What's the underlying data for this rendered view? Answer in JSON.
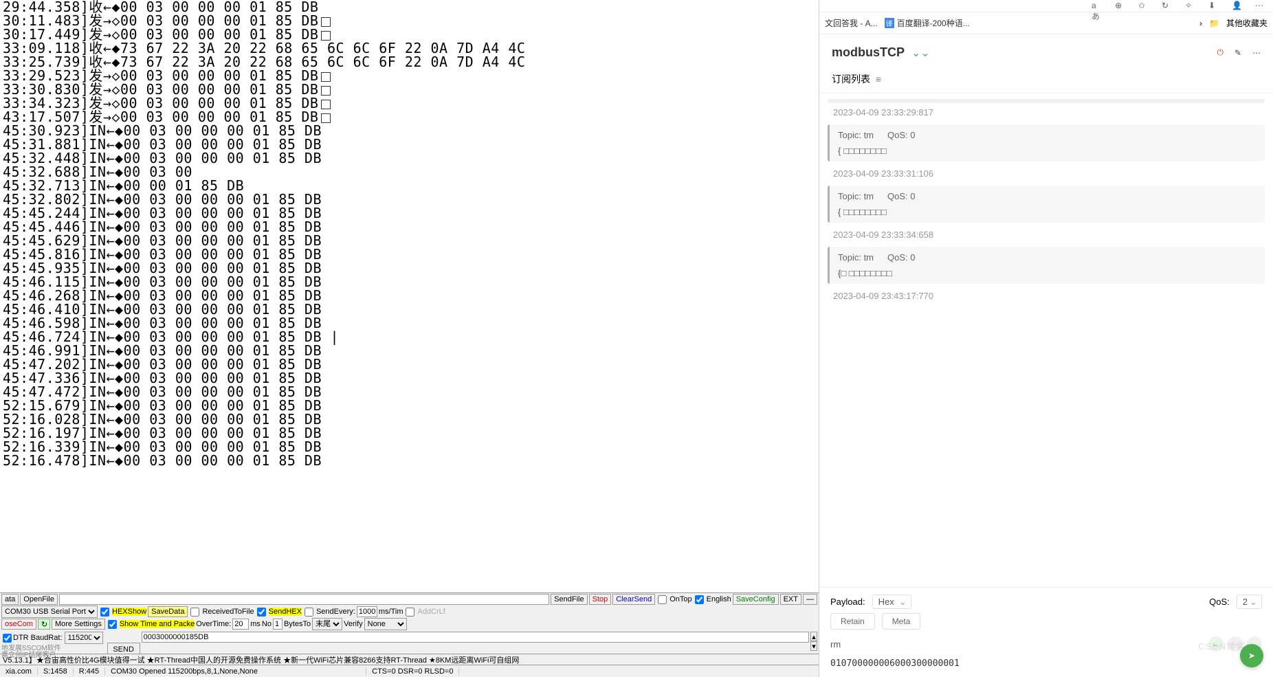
{
  "log": [
    {
      "t": "29:44.358",
      "d": "收←◆",
      "hex": "00 03 00 00 00 01 85 DB",
      "sq": false
    },
    {
      "t": "30:11.483",
      "d": "发→◇",
      "hex": "00 03 00 00 00 01 85 DB",
      "sq": true
    },
    {
      "t": "30:17.449",
      "d": "发→◇",
      "hex": "00 03 00 00 00 01 85 DB",
      "sq": true
    },
    {
      "t": "33:09.118",
      "d": "收←◆",
      "hex": "73 67 22 3A 20 22 68 65 6C 6C 6F 22 0A 7D A4 4C",
      "sq": false
    },
    {
      "t": "33:25.739",
      "d": "收←◆",
      "hex": "73 67 22 3A 20 22 68 65 6C 6C 6F 22 0A 7D A4 4C",
      "sq": false
    },
    {
      "t": "33:29.523",
      "d": "发→◇",
      "hex": "00 03 00 00 00 01 85 DB",
      "sq": true
    },
    {
      "t": "33:30.830",
      "d": "发→◇",
      "hex": "00 03 00 00 00 01 85 DB",
      "sq": true
    },
    {
      "t": "33:34.323",
      "d": "发→◇",
      "hex": "00 03 00 00 00 01 85 DB",
      "sq": true
    },
    {
      "t": "43:17.507",
      "d": "发→◇",
      "hex": "00 03 00 00 00 01 85 DB",
      "sq": true
    },
    {
      "t": "45:30.923",
      "d": "IN←◆",
      "hex": "00 03 00 00 00 01 85 DB",
      "sq": false
    },
    {
      "t": "45:31.881",
      "d": "IN←◆",
      "hex": "00 03 00 00 00 01 85 DB",
      "sq": false
    },
    {
      "t": "45:32.448",
      "d": "IN←◆",
      "hex": "00 03 00 00 00 01 85 DB",
      "sq": false
    },
    {
      "t": "45:32.688",
      "d": "IN←◆",
      "hex": "00 03 00",
      "sq": false
    },
    {
      "t": "45:32.713",
      "d": "IN←◆",
      "hex": "00 00 01 85 DB",
      "sq": false
    },
    {
      "t": "45:32.802",
      "d": "IN←◆",
      "hex": "00 03 00 00 00 01 85 DB",
      "sq": false
    },
    {
      "t": "45:45.244",
      "d": "IN←◆",
      "hex": "00 03 00 00 00 01 85 DB",
      "sq": false
    },
    {
      "t": "45:45.446",
      "d": "IN←◆",
      "hex": "00 03 00 00 00 01 85 DB",
      "sq": false
    },
    {
      "t": "45:45.629",
      "d": "IN←◆",
      "hex": "00 03 00 00 00 01 85 DB",
      "sq": false
    },
    {
      "t": "45:45.816",
      "d": "IN←◆",
      "hex": "00 03 00 00 00 01 85 DB",
      "sq": false
    },
    {
      "t": "45:45.935",
      "d": "IN←◆",
      "hex": "00 03 00 00 00 01 85 DB",
      "sq": false
    },
    {
      "t": "45:46.115",
      "d": "IN←◆",
      "hex": "00 03 00 00 00 01 85 DB",
      "sq": false
    },
    {
      "t": "45:46.268",
      "d": "IN←◆",
      "hex": "00 03 00 00 00 01 85 DB",
      "sq": false
    },
    {
      "t": "45:46.410",
      "d": "IN←◆",
      "hex": "00 03 00 00 00 01 85 DB",
      "sq": false
    },
    {
      "t": "45:46.598",
      "d": "IN←◆",
      "hex": "00 03 00 00 00 01 85 DB",
      "sq": false
    },
    {
      "t": "45:46.724",
      "d": "IN←◆",
      "hex": "00 03 00 00 00 01 85 DB |",
      "sq": false
    },
    {
      "t": "45:46.991",
      "d": "IN←◆",
      "hex": "00 03 00 00 00 01 85 DB",
      "sq": false
    },
    {
      "t": "45:47.202",
      "d": "IN←◆",
      "hex": "00 03 00 00 00 01 85 DB",
      "sq": false
    },
    {
      "t": "45:47.336",
      "d": "IN←◆",
      "hex": "00 03 00 00 00 01 85 DB",
      "sq": false
    },
    {
      "t": "45:47.472",
      "d": "IN←◆",
      "hex": "00 03 00 00 00 01 85 DB",
      "sq": false
    },
    {
      "t": "52:15.679",
      "d": "IN←◆",
      "hex": "00 03 00 00 00 01 85 DB",
      "sq": false
    },
    {
      "t": "52:16.028",
      "d": "IN←◆",
      "hex": "00 03 00 00 00 01 85 DB",
      "sq": false
    },
    {
      "t": "52:16.197",
      "d": "IN←◆",
      "hex": "00 03 00 00 00 01 85 DB",
      "sq": false
    },
    {
      "t": "52:16.339",
      "d": "IN←◆",
      "hex": "00 03 00 00 00 01 85 DB",
      "sq": false
    },
    {
      "t": "52:16.478",
      "d": "IN←◆",
      "hex": "00 03 00 00 00 01 85 DB",
      "sq": false
    }
  ],
  "ctrl": {
    "ata": "ata",
    "openFile": "OpenFile",
    "sendFile": "SendFile",
    "stop": "Stop",
    "clearSend": "ClearSend",
    "onTop": "OnTop",
    "english": "English",
    "saveConfig": "SaveConfig",
    "ext": "EXT",
    "port": "COM30 USB Serial Port",
    "hexShow": "HEXShow",
    "saveData": "SaveData",
    "receivedToFile": "ReceivedToFile",
    "sendHex": "SendHEX",
    "sendEvery": "SendEvery:",
    "everyVal": "1000",
    "msTim": "ms/Tim",
    "addCrLf": "AddCrLf",
    "oseCom": "oseCom",
    "moreSettings": "More Settings",
    "showTime": "Show Time and Packe",
    "overTime": "OverTime:",
    "otVal": "20",
    "ms": "ms",
    "no": "No",
    "noVal": "1",
    "bytesTo": "BytesTo",
    "tail": "末尾",
    "verify": "Verify",
    "verifyVal": "None",
    "dtr": "DTR",
    "baudRate": "BaudRat:",
    "baudVal": "115200",
    "sendVal": "0003000000185DB",
    "send": "SEND",
    "sideText1": "地发展SSCOM软件",
    "sideText2": "嘉立创IP结尾客户",
    "marquee": "V5.13.1】★合宙高性价比4G模块值得一试 ★RT-Thread中国人的开源免费操作系统 ★新一代WiFi芯片兼容8266支持RT-Thread ★8KM远距离WiFi可自组网"
  },
  "status": {
    "site": "xia.com",
    "s": "S:1458",
    "r": "R:445",
    "com": "COM30 Opened  115200bps,8,1,None,None",
    "cts": "CTS=0 DSR=0 RLSD=0"
  },
  "browser": {
    "tab1": "文回答我 - A...",
    "tab2": "百度翻译-200种语...",
    "folder": "其他收藏夹"
  },
  "mqtt": {
    "title": "modbusTCP",
    "subHeader": "订阅列表",
    "messages": [
      {
        "time": "2023-04-09 23:33:29:817",
        "topic": "Topic: tm",
        "qos": "QoS: 0",
        "body": "{     □□□□□□□□"
      },
      {
        "time": "2023-04-09 23:33:31:106",
        "topic": "Topic: tm",
        "qos": "QoS: 0",
        "body": "{     □□□□□□□□"
      },
      {
        "time": "2023-04-09 23:33:34:658",
        "topic": "Topic: tm",
        "qos": "QoS: 0",
        "body": "{□   □□□□□□□□"
      },
      {
        "time": "2023-04-09 23:43:17:770"
      }
    ],
    "payload": "Payload:",
    "payloadSel": "Hex",
    "qosLabel": "QoS:",
    "qosSel": "2",
    "retain": "Retain",
    "meta": "Meta",
    "rm": "rm",
    "hexOut": "010700000006000300000001",
    "watermark": "CSDN博客"
  }
}
